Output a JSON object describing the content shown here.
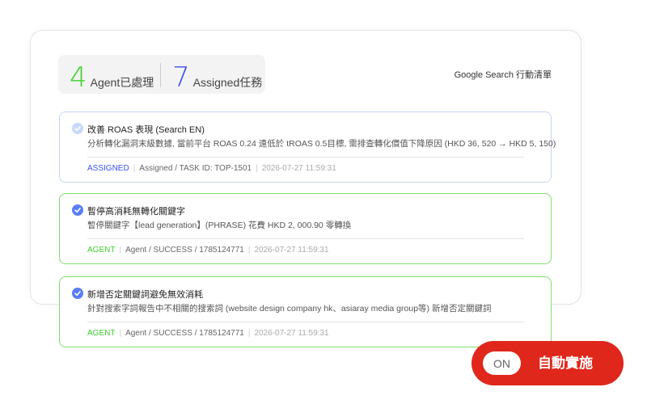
{
  "stats": {
    "agent_count": "4",
    "agent_label": "Agent已處理",
    "assigned_count": "7",
    "assigned_label": "Assigned任務"
  },
  "list_title": "Google Search 行動清單",
  "cards": [
    {
      "title": "改善 ROAS 表現 (Search EN)",
      "description": "分析轉化漏洞末級數據, 當前平台 ROAS 0.24 遠低於 tROAS 0.5目標, 需排查轉化價值下降原因 (HKD 36, 520 → HKD 5, 150)",
      "type": "ASSIGNED",
      "detail": "Assigned / TASK ID: TOP-1501",
      "time": "2026-07-27 11:59:31"
    },
    {
      "title": "暫停高消耗無轉化關鍵字",
      "description": "暫停關鍵字【lead generation】(PHRASE) 花費 HKD 2, 000.90 零轉換",
      "type": "AGENT",
      "detail": "Agent / SUCCESS / 1785124771",
      "time": "2026-07-27 11:59:31"
    },
    {
      "title": "新增否定關鍵詞避免無效消耗",
      "description": "針對搜索字詞報告中不相關的搜索詞 (website design company hk、asiaray media group等) 新增否定關鍵詞",
      "type": "AGENT",
      "detail": "Agent / SUCCESS / 1785124771",
      "time": "2026-07-27 11:59:31"
    }
  ],
  "toggle": {
    "state": "ON",
    "label": "自動實施"
  },
  "colors": {
    "agent": "#3ecf2e",
    "assigned": "#3b4ff0",
    "toggle": "#e0271b"
  }
}
